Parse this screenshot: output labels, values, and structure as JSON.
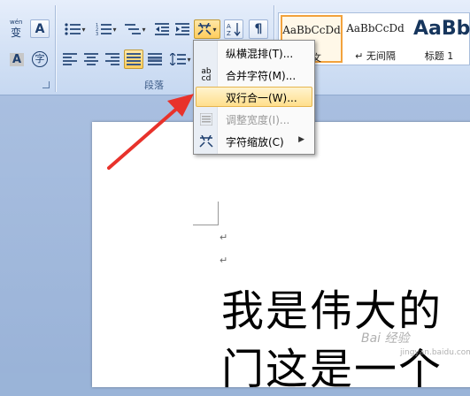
{
  "paragraph_group": {
    "label": "段落"
  },
  "font_buttons": {
    "phonetic_guide_text": "wén",
    "phonetic_guide_char": "变",
    "char_border": "A",
    "char_shading": "A",
    "enclose_char": "字"
  },
  "styles": [
    {
      "sample": "AaBbCcDd",
      "name": "正文",
      "active": true
    },
    {
      "sample": "AaBbCcDd",
      "name": "↵ 无间隔",
      "active": false
    },
    {
      "sample": "AaBb",
      "name": "标题 1",
      "active": false
    }
  ],
  "menu": {
    "items": [
      {
        "label": "纵横混排(T)...",
        "icon": "vertical-in-horizontal-icon",
        "highlighted": false,
        "disabled": false,
        "submenu": false
      },
      {
        "label": "合并字符(M)...",
        "icon": "combine-characters-icon",
        "icon_text": "ab\ncd",
        "highlighted": false,
        "disabled": false,
        "submenu": false
      },
      {
        "label": "双行合一(W)...",
        "icon": "two-lines-in-one-icon",
        "highlighted": true,
        "disabled": false,
        "submenu": false
      },
      {
        "label": "调整宽度(I)...",
        "icon": "fit-text-icon",
        "highlighted": false,
        "disabled": true,
        "submenu": false
      },
      {
        "label": "字符缩放(C)",
        "icon": "character-scale-icon",
        "highlighted": false,
        "disabled": false,
        "submenu": true
      }
    ]
  },
  "document": {
    "para_mark": "↵",
    "lines": [
      "我是伟大的",
      "门这是一个"
    ]
  },
  "watermark": {
    "text": "Bai 经验",
    "url": "jingyan.baidu.com"
  },
  "colors": {
    "ribbon": "#d6e3f6",
    "highlight": "#ffdf8c",
    "arrow": "#e8322b",
    "style_active_border": "#f2a23c"
  }
}
